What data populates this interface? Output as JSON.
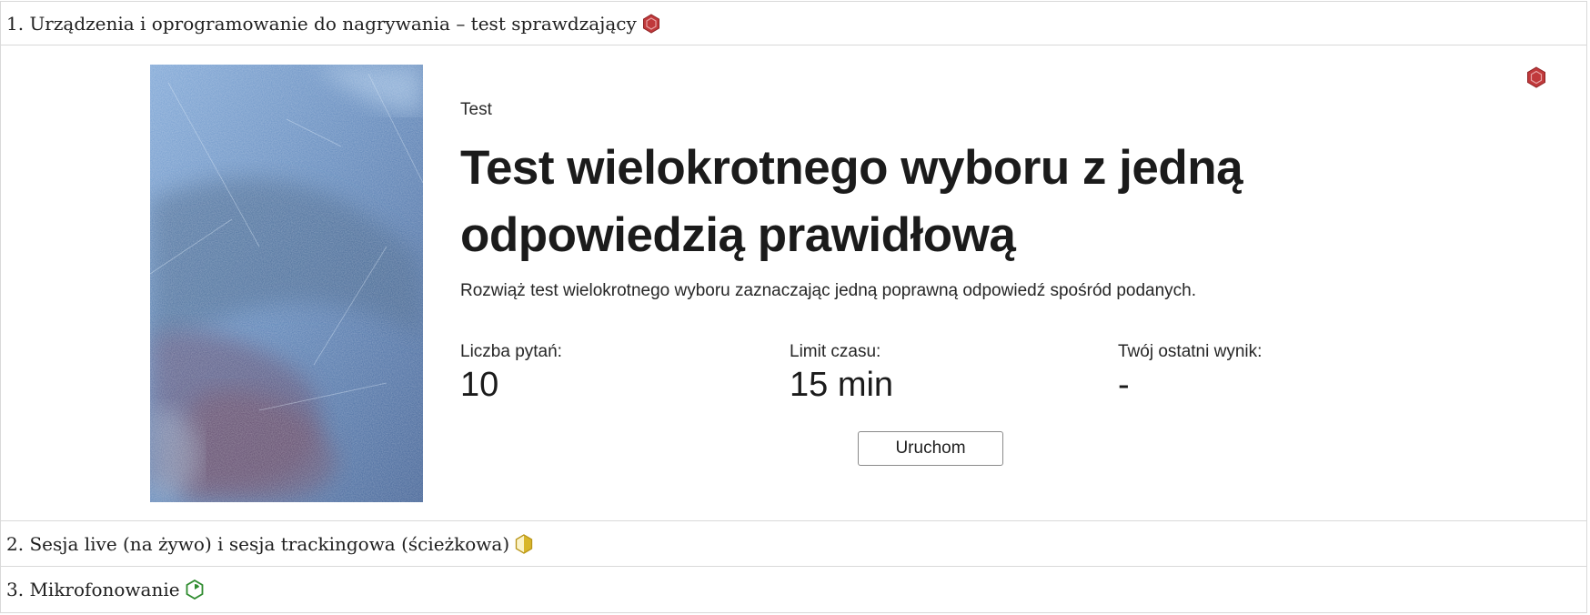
{
  "sections": [
    {
      "title": "1. Urządzenia i oprogramowanie do nagrywania – test sprawdzający",
      "status_icon": "hexagon-red-icon",
      "status_color": "#c0393b"
    },
    {
      "title": "2. Sesja live (na żywo) i sesja trackingowa (ścieżkowa)",
      "status_icon": "hexagon-half-yellow-icon",
      "status_color": "#d8b62a"
    },
    {
      "title": "3. Mikrofonowanie",
      "status_icon": "hexagon-green-progress-icon",
      "status_color": "#2e8b2e"
    }
  ],
  "activity": {
    "kicker": "Test",
    "title": "Test wielokrotnego wyboru z jedną odpowiedzią prawidłową",
    "description": "Rozwiąż test wielokrotnego wyboru zaznaczając jedną poprawną odpowiedź spośród podanych.",
    "stats": [
      {
        "label": "Liczba pytań:",
        "value": "10"
      },
      {
        "label": "Limit czasu:",
        "value": "15 min"
      },
      {
        "label": "Twój ostatni wynik:",
        "value": "-"
      }
    ],
    "start_label": "Uruchom",
    "corner_icon": "hexagon-red-icon",
    "corner_color": "#c0393b"
  }
}
